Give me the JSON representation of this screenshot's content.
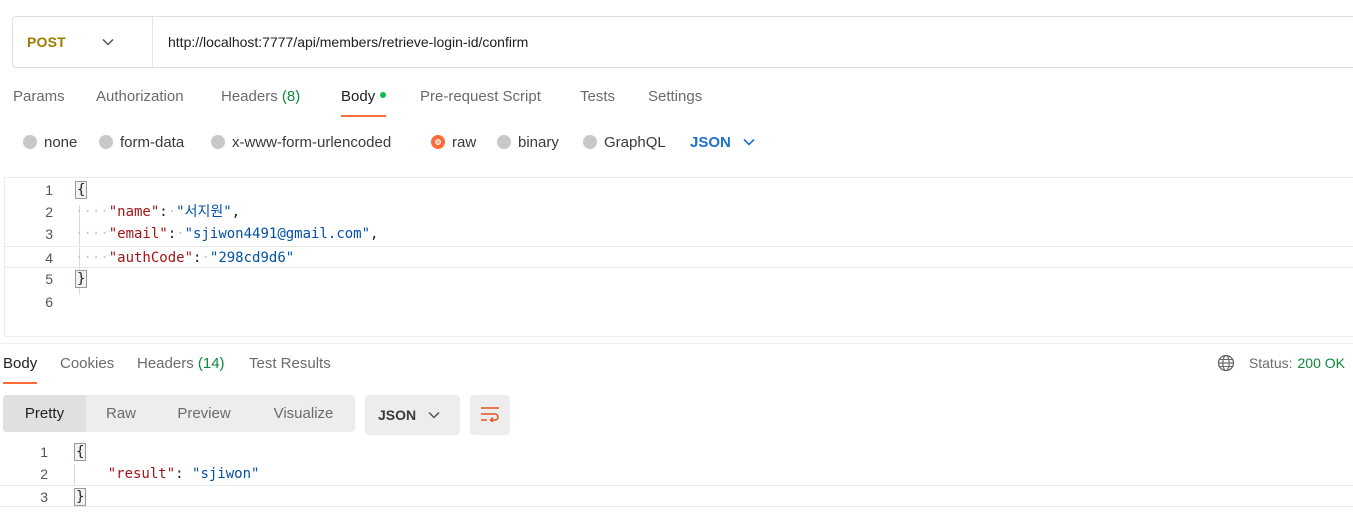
{
  "request": {
    "method": "POST",
    "url": "http://localhost:7777/api/members/retrieve-login-id/confirm"
  },
  "request_tabs": [
    {
      "label": "Params"
    },
    {
      "label": "Authorization"
    },
    {
      "label": "Headers",
      "count": "(8)"
    },
    {
      "label": "Body"
    },
    {
      "label": "Pre-request Script"
    },
    {
      "label": "Tests"
    },
    {
      "label": "Settings"
    }
  ],
  "body_types": [
    "none",
    "form-data",
    "x-www-form-urlencoded",
    "raw",
    "binary",
    "GraphQL"
  ],
  "body_format": "JSON",
  "request_body": {
    "line_numbers": [
      "1",
      "2",
      "3",
      "4",
      "5",
      "6"
    ],
    "open_brace": "{",
    "close_brace": "}",
    "fields": [
      {
        "key": "\"name\"",
        "value": "\"서지원\"",
        "sep": ","
      },
      {
        "key": "\"email\"",
        "value": "\"sjiwon4491@gmail.com\"",
        "sep": ","
      },
      {
        "key": "\"authCode\"",
        "value": "\"298cd9d6\"",
        "sep": ""
      }
    ]
  },
  "response_tabs": [
    {
      "label": "Body"
    },
    {
      "label": "Cookies"
    },
    {
      "label": "Headers",
      "count": "(14)"
    },
    {
      "label": "Test Results"
    }
  ],
  "status": {
    "label": "Status:",
    "value": "200 OK"
  },
  "view_modes": [
    "Pretty",
    "Raw",
    "Preview",
    "Visualize"
  ],
  "response_format": "JSON",
  "response_body": {
    "line_numbers": [
      "1",
      "2",
      "3"
    ],
    "open_brace": "{",
    "close_brace": "}",
    "key": "\"result\"",
    "value": "\"sjiwon\""
  },
  "colors": {
    "accent": "#ff6c37",
    "method": "#a07a00",
    "success": "#0b8a3a",
    "link": "#1f6fd0"
  },
  "icons": [
    "chevron-down-icon",
    "globe-icon",
    "wrap-lines-icon"
  ]
}
